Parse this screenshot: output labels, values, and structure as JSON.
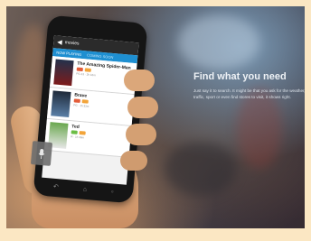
{
  "hero": {
    "headline": "Find what you need",
    "body": "Just say it to search. It might be that you ask for the weather, traffic, sport or even find stores to visit, it shows right."
  },
  "phone": {
    "search_query": "movies",
    "tabs": [
      {
        "label": "NOW PLAYING"
      },
      {
        "label": "COMING SOON"
      }
    ],
    "results": [
      {
        "title": "The Amazing Spider-Man",
        "meta": "PG-13 · 2h 16m"
      },
      {
        "title": "Brave",
        "meta": "PG · 1h 33m"
      },
      {
        "title": "Ted",
        "meta": "R · 1h 46m"
      }
    ]
  },
  "icons": {
    "back": "chevron-left-icon",
    "mic": "microphone-icon",
    "nav_back": "back-icon",
    "nav_home": "home-icon",
    "nav_recent": "recent-apps-icon"
  },
  "colors": {
    "accent": "#1e8fd1",
    "frame": "#fbe7c3"
  }
}
